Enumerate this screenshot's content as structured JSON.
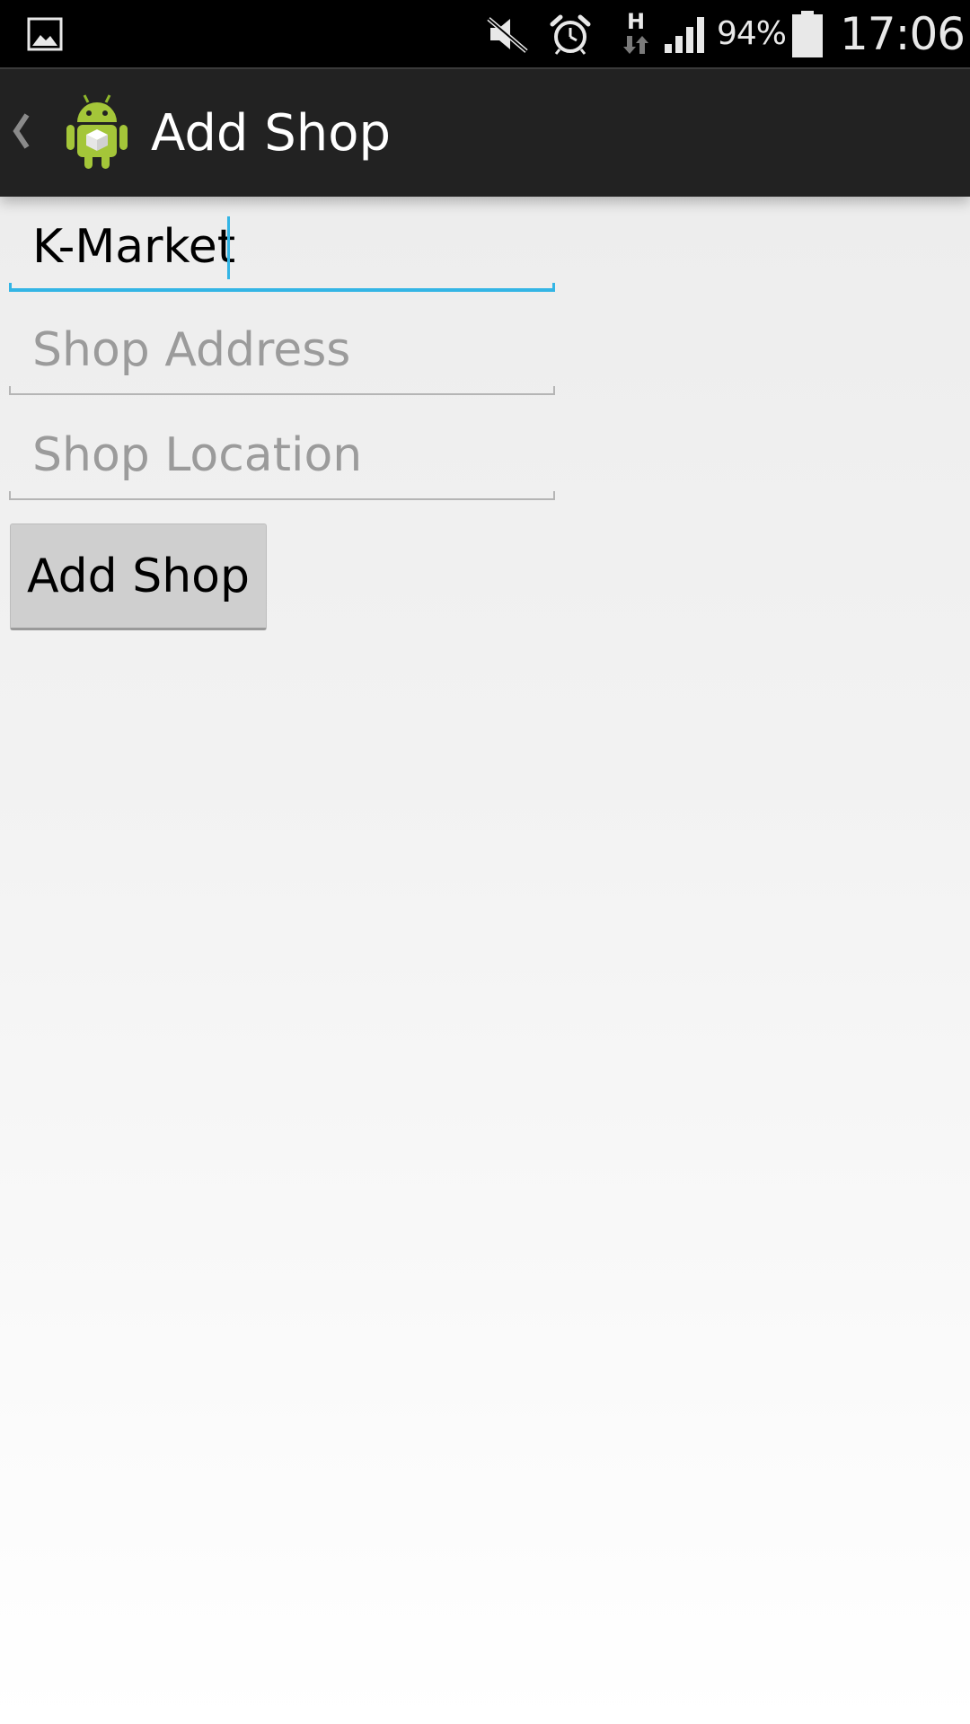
{
  "status_bar": {
    "battery_percent": "94%",
    "time": "17:06",
    "network_type": "H",
    "icons": [
      "gallery-icon",
      "mute-icon",
      "alarm-icon",
      "network-h-icon",
      "signal-icon",
      "battery-icon"
    ]
  },
  "action_bar": {
    "title": "Add Shop",
    "app_icon": "android-robot-icon",
    "back_icon": "back-caret-icon"
  },
  "form": {
    "shop_name": {
      "value": "K-Market",
      "placeholder": ""
    },
    "shop_address": {
      "value": "",
      "placeholder": "Shop Address"
    },
    "shop_location": {
      "value": "",
      "placeholder": "Shop Location"
    },
    "submit_label": "Add Shop"
  },
  "colors": {
    "accent": "#33b5e5",
    "action_bar": "#222222",
    "status_bar": "#000000",
    "android_green": "#a4c639"
  }
}
